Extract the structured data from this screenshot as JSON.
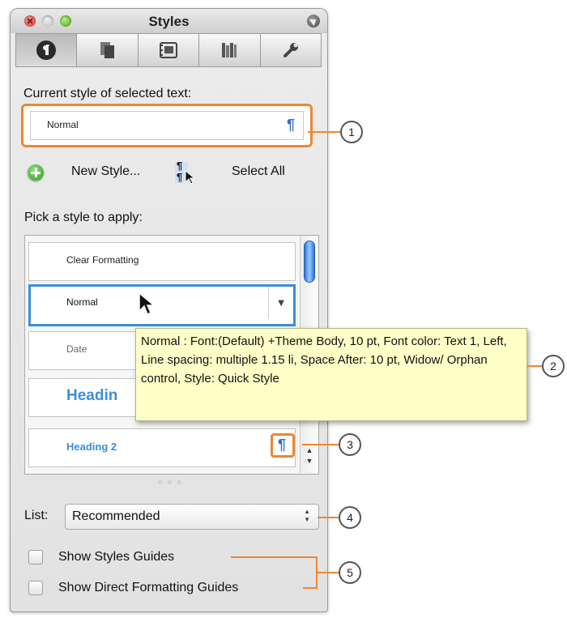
{
  "window": {
    "title": "Styles"
  },
  "toolbar": {
    "tabs": [
      {
        "icon": "paragraph-icon",
        "active": true
      },
      {
        "icon": "copy-pages-icon",
        "active": false
      },
      {
        "icon": "image-gallery-icon",
        "active": false
      },
      {
        "icon": "books-icon",
        "active": false
      },
      {
        "icon": "wrench-icon",
        "active": false
      }
    ]
  },
  "current": {
    "label": "Current style of selected text:",
    "value": "Normal",
    "mark": "¶"
  },
  "actions": {
    "new_style": "New Style...",
    "select_all": "Select All"
  },
  "pick": {
    "label": "Pick a style to apply:",
    "items": [
      "Clear Formatting",
      "Normal",
      "Date",
      "Headin",
      "Heading 2"
    ],
    "dropdown_glyph": "▼",
    "mark": "¶"
  },
  "tooltip": {
    "text": "Normal : Font:(Default) +Theme Body, 10 pt, Font color: Text 1, Left, Line spacing: multiple 1.15 li, Space After:  10 pt, Widow/ Orphan control, Style: Quick Style"
  },
  "resize_dots": "○ ○ ○",
  "list": {
    "label": "List:",
    "value": "Recommended"
  },
  "checkboxes": [
    {
      "label": "Show Styles Guides",
      "checked": false
    },
    {
      "label": "Show Direct Formatting Guides",
      "checked": false
    }
  ],
  "callouts": [
    "1",
    "2",
    "3",
    "4",
    "5"
  ],
  "colors": {
    "accent_orange": "#f0862f",
    "style_blue": "#3a8fdb",
    "tooltip_bg": "#ffffc8"
  }
}
